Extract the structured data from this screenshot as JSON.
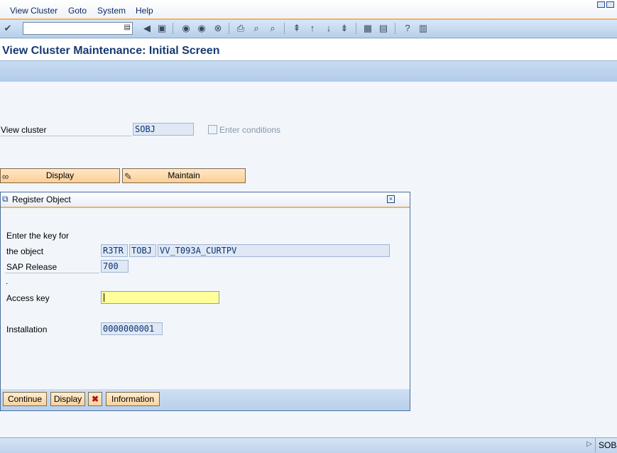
{
  "menu": {
    "items": [
      {
        "label": "View Cluster"
      },
      {
        "label": "Goto"
      },
      {
        "label": "System"
      },
      {
        "label": "Help"
      }
    ]
  },
  "toolbar": {
    "command_value": "",
    "icons": [
      "enter-icon",
      "back-icon",
      "save-icon",
      "back-nav-icon",
      "exit-icon",
      "cancel-icon",
      "print-icon",
      "find-icon",
      "find-next-icon",
      "first-page-icon",
      "previous-page-icon",
      "next-page-icon",
      "last-page-icon",
      "create-session-icon",
      "shortcut-icon",
      "help-icon",
      "layout-icon"
    ]
  },
  "page": {
    "title": "View Cluster Maintenance: Initial Screen"
  },
  "main": {
    "view_cluster_label": "View cluster",
    "view_cluster_value": "SOBJ",
    "enter_conditions_label": "Enter conditions",
    "display_button": "Display",
    "maintain_button": "Maintain"
  },
  "dialog": {
    "title": "Register Object",
    "line1": "Enter the key for",
    "line2": "the object",
    "key_parts": [
      "R3TR",
      "TOBJ",
      "VV_T093A_CURTPV"
    ],
    "sap_release_label": "SAP Release",
    "sap_release_value": "700",
    "dot": ".",
    "access_key_label": "Access key",
    "access_key_value": "",
    "installation_label": "Installation",
    "installation_value": "0000000001",
    "buttons": {
      "continue": "Continue",
      "display": "Display",
      "cancel": "✖",
      "information": "Information"
    }
  },
  "status": {
    "system": "SOBJ"
  },
  "colors": {
    "title": "#173a73",
    "accent_orange": "#f4b25a",
    "input_required": "#ffff9c"
  }
}
